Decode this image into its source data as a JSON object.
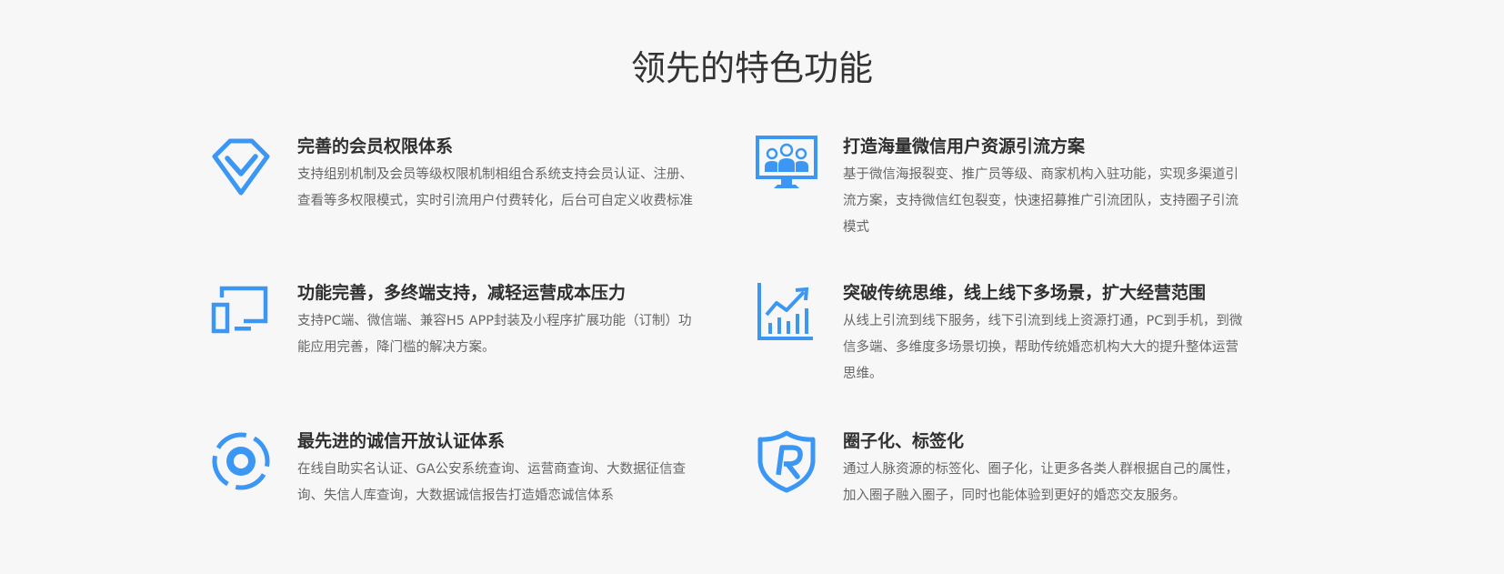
{
  "section": {
    "title": "领先的特色功能"
  },
  "colors": {
    "accent": "#3b97f3",
    "title_text": "#2f2f2f",
    "desc_text": "#666666",
    "background": "#f7f7f7"
  },
  "features": [
    {
      "icon": "diamond-check-icon",
      "title": "完善的会员权限体系",
      "description": "支持组别机制及会员等级权限机制相组合系统支持会员认证、注册、查看等多权限模式，实时引流用户付费转化，后台可自定义收费标准"
    },
    {
      "icon": "group-monitor-icon",
      "title": "打造海量微信用户资源引流方案",
      "description": "基于微信海报裂变、推广员等级、商家机构入驻功能，实现多渠道引流方案，支持微信红包裂变，快速招募推广引流团队，支持圈子引流模式"
    },
    {
      "icon": "multi-device-icon",
      "title": "功能完善，多终端支持，减轻运营成本压力",
      "description": "支持PC端、微信端、兼容H5 APP封装及小程序扩展功能（订制）功能应用完善，降门槛的解决方案。"
    },
    {
      "icon": "growth-chart-icon",
      "title": "突破传统思维，线上线下多场景，扩大经营范围",
      "description": "从线上引流到线下服务，线下引流到线上资源打通，PC到手机，到微信多端、多维度多场景切换，帮助传统婚恋机构大大的提升整体运营思维。"
    },
    {
      "icon": "target-circle-icon",
      "title": "最先进的诚信开放认证体系",
      "description": "在线自助实名认证、GA公安系统查询、运营商查询、大数据征信查询、失信人库查询，大数据诚信报告打造婚恋诚信体系"
    },
    {
      "icon": "shield-r-icon",
      "title": "圈子化、标签化",
      "description": "通过人脉资源的标签化、圈子化，让更多各类人群根据自己的属性，加入圈子融入圈子，同时也能体验到更好的婚恋交友服务。"
    }
  ]
}
